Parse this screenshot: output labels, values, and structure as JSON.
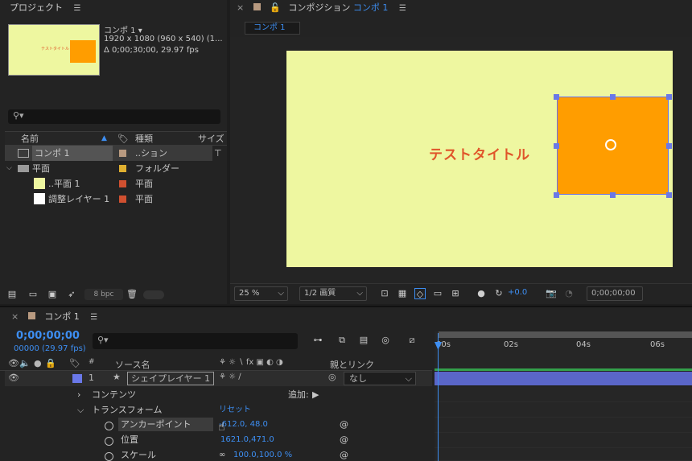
{
  "project": {
    "tab_label": "プロジェクト",
    "comp_name": "コンポ 1 ▾",
    "comp_size": "1920 x 1080  (960 x 540) (1...",
    "comp_duration": "Δ 0;00;30;00, 29.97 fps",
    "thumb_title": "テストタイトル",
    "columns": {
      "name": "名前",
      "type": "種類",
      "size": "サイズ"
    },
    "items": [
      {
        "name": "コンポ 1",
        "type": "..ション",
        "color": "#b89a80"
      },
      {
        "name": "平面",
        "type": "フォルダー",
        "color": "#e0b030"
      },
      {
        "name": "..平面 1",
        "type": "平面",
        "color": "#d05030"
      },
      {
        "name": "調整レイヤー 1",
        "type": "平面",
        "color": "#d05030"
      }
    ],
    "bpc_label": "8 bpc"
  },
  "composition": {
    "tab_label": "コンポジション",
    "tab_comp_name": "コンポ 1",
    "subtab_label": "コンポ 1",
    "canvas_title": "テストタイトル",
    "canvas_color": "#eef7a0",
    "shape_color": "#ff9d00",
    "zoom": "25 %",
    "quality": "1/2 画質",
    "exposure": "+0.0",
    "timecode": "0;00;00;00"
  },
  "timeline": {
    "tab_label": "コンポ 1",
    "timecode": "0;00;00;00",
    "timecode_sub": "00000 (29.97 fps)",
    "columns": {
      "num": "#",
      "source": "ソース名",
      "parent": "親とリンク"
    },
    "layer": {
      "num": "1",
      "name": "シェイプレイヤー 1",
      "parent": "なし"
    },
    "contents_label": "コンテンツ",
    "add_label": "追加:",
    "transform_label": "トランスフォーム",
    "reset_label": "リセット",
    "properties": [
      {
        "name": "アンカーポイント",
        "value": "-612.0, 48.0"
      },
      {
        "name": "位置",
        "value": "1621.0,471.0"
      },
      {
        "name": "スケール",
        "value": "100.0,100.0 %"
      }
    ],
    "ruler_ticks": [
      "00s",
      "02s",
      "04s",
      "06s"
    ]
  }
}
